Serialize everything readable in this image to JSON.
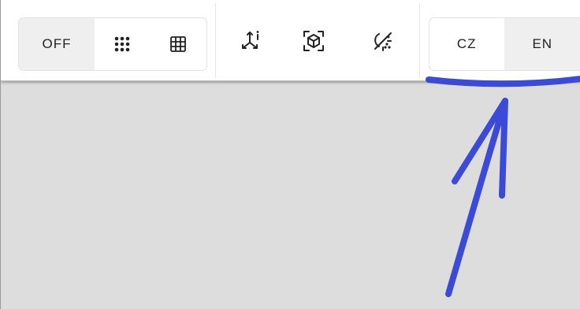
{
  "toolbar": {
    "grid_mode": {
      "off_label": "OFF",
      "selected": "OFF",
      "icons": [
        "dots-grid-icon",
        "grid-icon"
      ]
    },
    "view_tools": {
      "icons": [
        "axes-info-icon",
        "cube-focus-icon",
        "light-off-icon"
      ]
    },
    "language": {
      "options": [
        "CZ",
        "EN"
      ],
      "selected": "EN"
    }
  },
  "colors": {
    "toolbar_bg": "#ffffff",
    "viewport_bg": "#dddddd",
    "selected_segment_bg": "#efefef",
    "annotation_blue": "#3b4bd6"
  }
}
